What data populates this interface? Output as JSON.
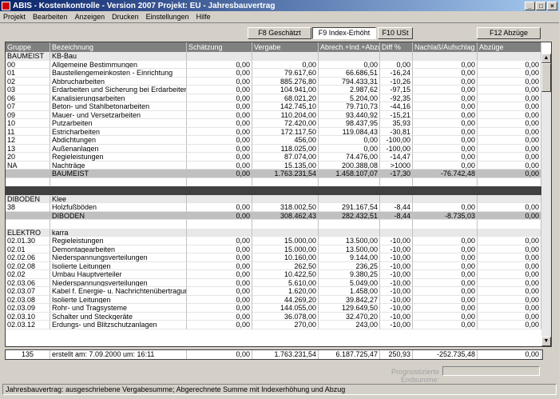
{
  "window": {
    "title": "ABIS - Kostenkontrolle - Version 2007  Projekt: EU - Jahresbauvertrag"
  },
  "menu": [
    "Projekt",
    "Bearbeiten",
    "Anzeigen",
    "Drucken",
    "Einstellungen",
    "Hilfe"
  ],
  "buttons": {
    "f8": "F8 Geschätzt",
    "f9": "F9 Index-Erhöht",
    "f10": "F10 USt",
    "f12": "F12 Abzüge"
  },
  "columns": [
    "Gruppe",
    "Bezeichnung",
    "Schätzung",
    "Vergabe",
    "Abrech.+Ind.+Abzug",
    "Diff %",
    "Nachlaß/Aufschlag",
    "Abzüge"
  ],
  "rows": [
    {
      "t": "group",
      "c": [
        "BAUMEIST",
        "KB-Bau",
        "",
        "",
        "",
        "",
        "",
        ""
      ]
    },
    {
      "t": "",
      "c": [
        "00",
        "Allgemeine Bestimmungen",
        "0,00",
        "0,00",
        "0,00",
        "0,00",
        "0,00",
        "0,00"
      ]
    },
    {
      "t": "",
      "c": [
        "01",
        "Baustellengemeinkosten - Einrichtung",
        "0,00",
        "79.617,60",
        "66.686,51",
        "-16,24",
        "0,00",
        "0,00"
      ]
    },
    {
      "t": "",
      "c": [
        "02",
        "Abbrucharbeiten",
        "0,00",
        "885.276,80",
        "794.433,31",
        "-10,26",
        "0,00",
        "0,00"
      ]
    },
    {
      "t": "",
      "c": [
        "03",
        "Erdarbeiten und Sicherung bei Erdarbeiten",
        "0,00",
        "104.941,00",
        "2.987,62",
        "-97,15",
        "0,00",
        "0,00"
      ]
    },
    {
      "t": "",
      "c": [
        "06",
        "Kanalisierungsarbeiten",
        "0,00",
        "68.021,20",
        "5.204,00",
        "-92,35",
        "0,00",
        "0,00"
      ]
    },
    {
      "t": "",
      "c": [
        "07",
        "Beton- und Stahlbetonarbeiten",
        "0,00",
        "142.745,10",
        "79.710,73",
        "-44,16",
        "0,00",
        "0,00"
      ]
    },
    {
      "t": "",
      "c": [
        "09",
        "Mauer- und Versetzarbeiten",
        "0,00",
        "110.204,00",
        "93.440,92",
        "-15,21",
        "0,00",
        "0,00"
      ]
    },
    {
      "t": "",
      "c": [
        "10",
        "Putzarbeiten",
        "0,00",
        "72.420,00",
        "98.437,95",
        "35,93",
        "0,00",
        "0,00"
      ]
    },
    {
      "t": "",
      "c": [
        "11",
        "Estricharbeiten",
        "0,00",
        "172.117,50",
        "119.084,43",
        "-30,81",
        "0,00",
        "0,00"
      ]
    },
    {
      "t": "",
      "c": [
        "12",
        "Abdichtungen",
        "0,00",
        "456,00",
        "0,00",
        "-100,00",
        "0,00",
        "0,00"
      ]
    },
    {
      "t": "",
      "c": [
        "13",
        "Außenanlagen",
        "0,00",
        "118.025,00",
        "0,00",
        "-100,00",
        "0,00",
        "0,00"
      ]
    },
    {
      "t": "",
      "c": [
        "20",
        "Regieleistungen",
        "0,00",
        "87.074,00",
        "74.476,00",
        "-14,47",
        "0,00",
        "0,00"
      ]
    },
    {
      "t": "",
      "c": [
        "NA",
        "Nachträge",
        "0,00",
        "15.135,00",
        "200.388,08",
        ">1000",
        "0,00",
        "0,00"
      ]
    },
    {
      "t": "sum",
      "c": [
        "",
        "BAUMEIST",
        "0,00",
        "1.763.231,54",
        "1.458.107,07",
        "-17,30",
        "-76.742,48",
        "0,00"
      ]
    },
    {
      "t": "gap",
      "c": [
        "",
        "",
        "",
        "",
        "",
        "",
        "",
        ""
      ]
    },
    {
      "t": "blk",
      "c": [
        "",
        "",
        "",
        "",
        "",
        "",
        "",
        ""
      ]
    },
    {
      "t": "group",
      "c": [
        "DIBODEN",
        "Klee",
        "",
        "",
        "",
        "",
        "",
        ""
      ]
    },
    {
      "t": "",
      "c": [
        "38",
        "Holzfußböden",
        "0,00",
        "318.002,50",
        "291.167,54",
        "-8,44",
        "0,00",
        "0,00"
      ]
    },
    {
      "t": "sum",
      "c": [
        "",
        "DIBODEN",
        "0,00",
        "308.462,43",
        "282.432,51",
        "-8,44",
        "-8.735,03",
        "0,00"
      ]
    },
    {
      "t": "gap",
      "c": [
        "",
        "",
        "",
        "",
        "",
        "",
        "",
        ""
      ]
    },
    {
      "t": "group",
      "c": [
        "ELEKTRO",
        "karra",
        "",
        "",
        "",
        "",
        "",
        ""
      ]
    },
    {
      "t": "",
      "c": [
        "02.01.30",
        "Regieleistungen",
        "0,00",
        "15.000,00",
        "13.500,00",
        "-10,00",
        "0,00",
        "0,00"
      ]
    },
    {
      "t": "",
      "c": [
        "02.01",
        "Demontagearbeiten",
        "0,00",
        "15.000,00",
        "13.500,00",
        "-10,00",
        "0,00",
        "0,00"
      ]
    },
    {
      "t": "",
      "c": [
        "02.02.06",
        "Niederspannungsverteilungen",
        "0,00",
        "10.160,00",
        "9.144,00",
        "-10,00",
        "0,00",
        "0,00"
      ]
    },
    {
      "t": "",
      "c": [
        "02.02.08",
        "Isolierte Leitungen",
        "0,00",
        "262,50",
        "236,25",
        "-10,00",
        "0,00",
        "0,00"
      ]
    },
    {
      "t": "",
      "c": [
        "02.02",
        "Umbau Hauptverteiler",
        "0,00",
        "10.422,50",
        "9.380,25",
        "-10,00",
        "0,00",
        "0,00"
      ]
    },
    {
      "t": "",
      "c": [
        "02.03.06",
        "Niederspannungsverteilungen",
        "0,00",
        "5.610,00",
        "5.049,00",
        "-10,00",
        "0,00",
        "0,00"
      ]
    },
    {
      "t": "",
      "c": [
        "02.03.07",
        "Kabel f. Energie- u. Nachrichtenübertragung",
        "0,00",
        "1.620,00",
        "1.458,00",
        "-10,00",
        "0,00",
        "0,00"
      ]
    },
    {
      "t": "",
      "c": [
        "02.03.08",
        "Isolierte Leitungen",
        "0,00",
        "44.269,20",
        "39.842,27",
        "-10,00",
        "0,00",
        "0,00"
      ]
    },
    {
      "t": "",
      "c": [
        "02.03.09",
        "Rohr- und Tragsysteme",
        "0,00",
        "144.055,00",
        "129.649,50",
        "-10,00",
        "0,00",
        "0,00"
      ]
    },
    {
      "t": "",
      "c": [
        "02.03.10",
        "Schalter und Steckgeräte",
        "0,00",
        "36.078,00",
        "32.470,20",
        "-10,00",
        "0,00",
        "0,00"
      ]
    },
    {
      "t": "",
      "c": [
        "02.03.12",
        "Erdungs- und Blitzschutzanlagen",
        "0,00",
        "270,00",
        "243,00",
        "-10,00",
        "0,00",
        "0,00"
      ]
    }
  ],
  "totals": {
    "count": "135",
    "created": "erstellt am:  7.09.2000  um: 16:11",
    "schaetzung": "0,00",
    "vergabe": "1.763.231,54",
    "abrech": "6.187.725,47",
    "diff": "250,93",
    "nachlass": "-252.735,48",
    "abzuege": "0,00"
  },
  "prognose_label": "Prognostizierte Endsumme:",
  "status": "Jahresbauvertrag: ausgeschriebene Vergabesumme; Abgerechnete Summe mit Indexerhöhung und Abzug"
}
